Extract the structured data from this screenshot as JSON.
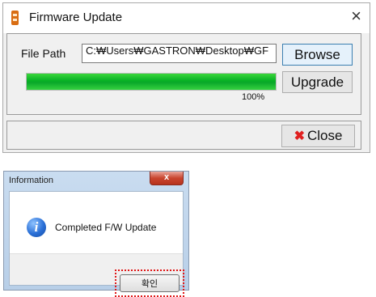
{
  "firmware_window": {
    "title": "Firmware Update",
    "close_glyph": "×",
    "file_path_label": "File Path",
    "file_path_value": "C:₩Users₩GASTRON₩Desktop₩GF",
    "browse_label": "Browse",
    "upgrade_label": "Upgrade",
    "progress_percent": 100,
    "progress_text": "100%",
    "close_button_label": "Close",
    "close_button_glyph": "✖",
    "accent_green": "#06b025"
  },
  "info_dialog": {
    "title": "Information",
    "close_glyph": "x",
    "message": "Completed F/W Update",
    "icon": "info-icon",
    "ok_label": "확인",
    "highlight_color": "#e01818"
  }
}
